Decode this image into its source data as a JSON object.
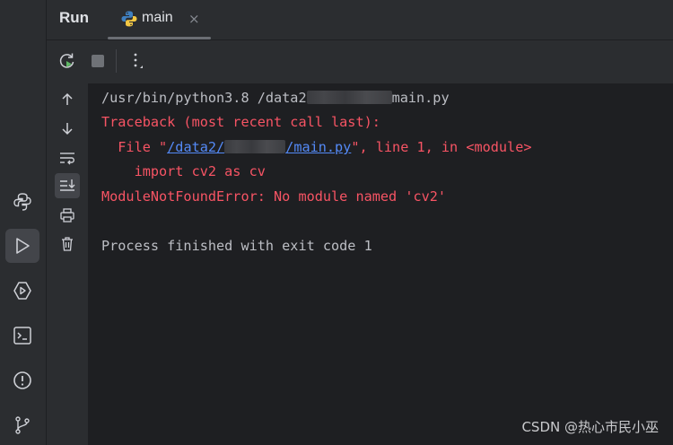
{
  "header": {
    "title": "Run",
    "tab": {
      "label": "main",
      "close": "×"
    }
  },
  "console": {
    "command": {
      "prefix": "/usr/bin/python3.8 /data2",
      "suffix": "main.py"
    },
    "traceback_header": "Traceback (most recent call last):",
    "file_line": {
      "lead": "  File \"",
      "path_start": "/data2/",
      "path_end": "/main.py",
      "trail": "\", line 1, in <module>"
    },
    "code_line": "    import cv2 as cv",
    "error": "ModuleNotFoundError: No module named 'cv2'",
    "finished": "Process finished with exit code 1"
  },
  "watermark": "CSDN @热心市民小巫",
  "colors": {
    "background": "#1e1f22",
    "panel": "#2b2d30",
    "error_red": "#f75464",
    "link_blue": "#548af7",
    "text": "#bcbec4"
  },
  "icons": {
    "activity": [
      "python-console-icon",
      "run-icon",
      "services-icon",
      "terminal-icon",
      "problems-icon",
      "git-icon"
    ],
    "toolbar": [
      "rerun-icon",
      "stop-icon",
      "more-icon"
    ],
    "side": [
      "scroll-up-icon",
      "scroll-down-icon",
      "soft-wrap-icon",
      "scroll-to-end-icon",
      "print-icon",
      "clear-all-icon"
    ]
  }
}
